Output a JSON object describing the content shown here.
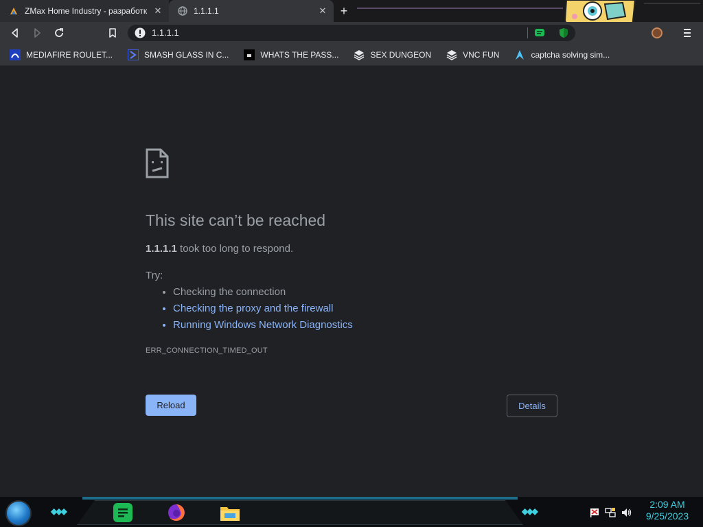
{
  "tabs": [
    {
      "title": "ZMax Home Industry - разработк",
      "favicon": "zmax-logo-icon",
      "active": false
    },
    {
      "title": "1.1.1.1",
      "favicon": "globe-icon",
      "active": true
    }
  ],
  "tab_close_glyph": "✕",
  "new_tab_glyph": "+",
  "address": {
    "url": "1.1.1.1",
    "security": "info-icon"
  },
  "bookmarks": [
    {
      "label": "MEDIAFIRE ROULET...",
      "icon": "mediafire-icon"
    },
    {
      "label": "SMASH GLASS IN C...",
      "icon": "chevron-bookmark-icon"
    },
    {
      "label": "WHATS THE PASS...",
      "icon": "dark-square-icon"
    },
    {
      "label": "SEX DUNGEON",
      "icon": "vnc-icon"
    },
    {
      "label": "VNC FUN",
      "icon": "vnc-icon"
    },
    {
      "label": "captcha solving sim...",
      "icon": "arch-icon"
    }
  ],
  "error": {
    "heading": "This site can’t be reached",
    "host": "1.1.1.1",
    "detail": "took too long to respond.",
    "try_label": "Try:",
    "suggestions": [
      {
        "text": "Checking the connection",
        "link": false
      },
      {
        "text": "Checking the proxy and the firewall",
        "link": true
      },
      {
        "text": "Running Windows Network Diagnostics",
        "link": true
      }
    ],
    "code": "ERR_CONNECTION_TIMED_OUT",
    "reload_label": "Reload",
    "details_label": "Details"
  },
  "taskbar": {
    "apps": [
      "spotify-icon",
      "firefox-icon",
      "file-explorer-icon"
    ],
    "tray": [
      "action-center-flag-icon",
      "network-icon",
      "volume-icon"
    ],
    "time": "2:09 AM",
    "date": "9/25/2023"
  },
  "colors": {
    "link": "#8ab4f8",
    "text": "#9aa0a6",
    "background": "#202124",
    "accent": "#3fd0e0"
  }
}
